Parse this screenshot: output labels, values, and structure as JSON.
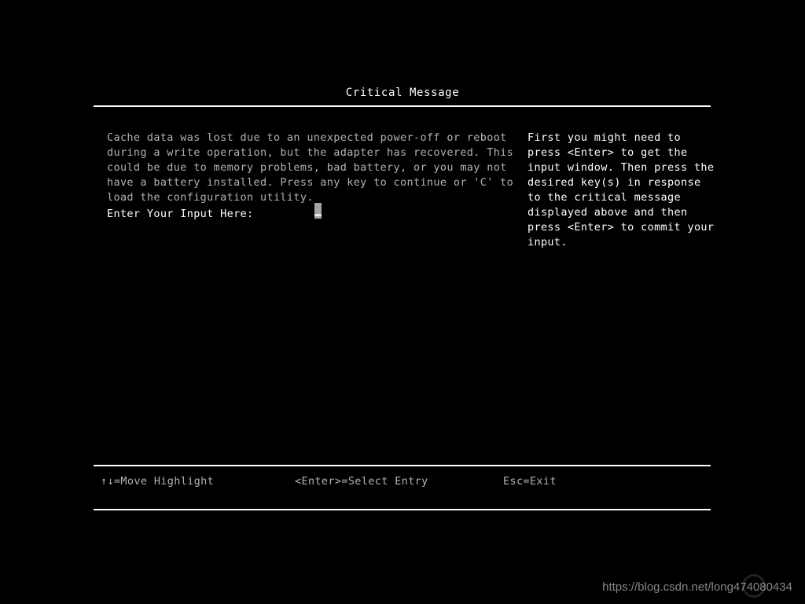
{
  "screen": {
    "background_color": "#000000",
    "text_color": "#b2b2b2",
    "highlight_color": "#ffffff"
  },
  "header": {
    "title": "Critical Message"
  },
  "message": {
    "lines": [
      "Cache data was lost due to an unexpected power-off or reboot",
      "during a write operation, but the adapter has recovered. This",
      "could be due to memory problems, bad battery, or you may not",
      "have a battery installed. Press any key to continue or 'C' to",
      "load the configuration utility."
    ],
    "input_label": "Enter Your Input Here:",
    "input_value": ""
  },
  "help": {
    "lines": [
      "First you might need to",
      "press <Enter> to get the",
      "input window. Then press the",
      "desired key(s) in response",
      "to the critical message",
      "displayed above and then",
      "press <Enter> to commit your",
      "input."
    ]
  },
  "footer": {
    "items": [
      "↑↓=Move Highlight",
      "<Enter>=Select Entry",
      "Esc=Exit"
    ]
  },
  "watermark": {
    "url": "https://blog.csdn.net/long474080434"
  }
}
